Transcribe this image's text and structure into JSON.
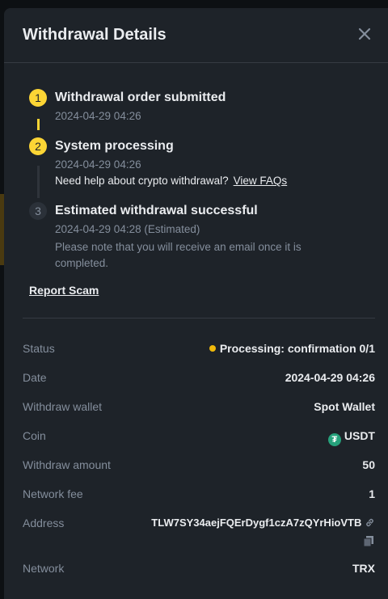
{
  "dialog": {
    "title": "Withdrawal Details"
  },
  "steps": [
    {
      "number": "1",
      "title": "Withdrawal order submitted",
      "time": "2024-04-29 04:26",
      "status": "done"
    },
    {
      "number": "2",
      "title": "System processing",
      "time": "2024-04-29 04:26",
      "note": "Need help about crypto withdrawal?",
      "link": "View FAQs",
      "status": "current"
    },
    {
      "number": "3",
      "title": "Estimated withdrawal successful",
      "time": "2024-04-29 04:28 (Estimated)",
      "description": "Please note that you will receive an email once it is completed.",
      "status": "pending"
    }
  ],
  "report_link": "Report Scam",
  "details": {
    "status": {
      "label": "Status",
      "value": "Processing: confirmation 0/1",
      "dot_color": "#f0b90b"
    },
    "date": {
      "label": "Date",
      "value": "2024-04-29 04:26"
    },
    "wallet": {
      "label": "Withdraw wallet",
      "value": "Spot Wallet"
    },
    "coin": {
      "label": "Coin",
      "value": "USDT",
      "icon": "tether-icon",
      "icon_color": "#26a17b"
    },
    "amount": {
      "label": "Withdraw amount",
      "value": "50"
    },
    "fee": {
      "label": "Network fee",
      "value": "1"
    },
    "address": {
      "label": "Address",
      "value": "TLW7SY34aejFQErDygf1czA7zQYrHioVTB"
    },
    "network": {
      "label": "Network",
      "value": "TRX"
    }
  },
  "colors": {
    "accent": "#fcd535",
    "panel": "#1e2329",
    "muted": "#848e9c"
  }
}
